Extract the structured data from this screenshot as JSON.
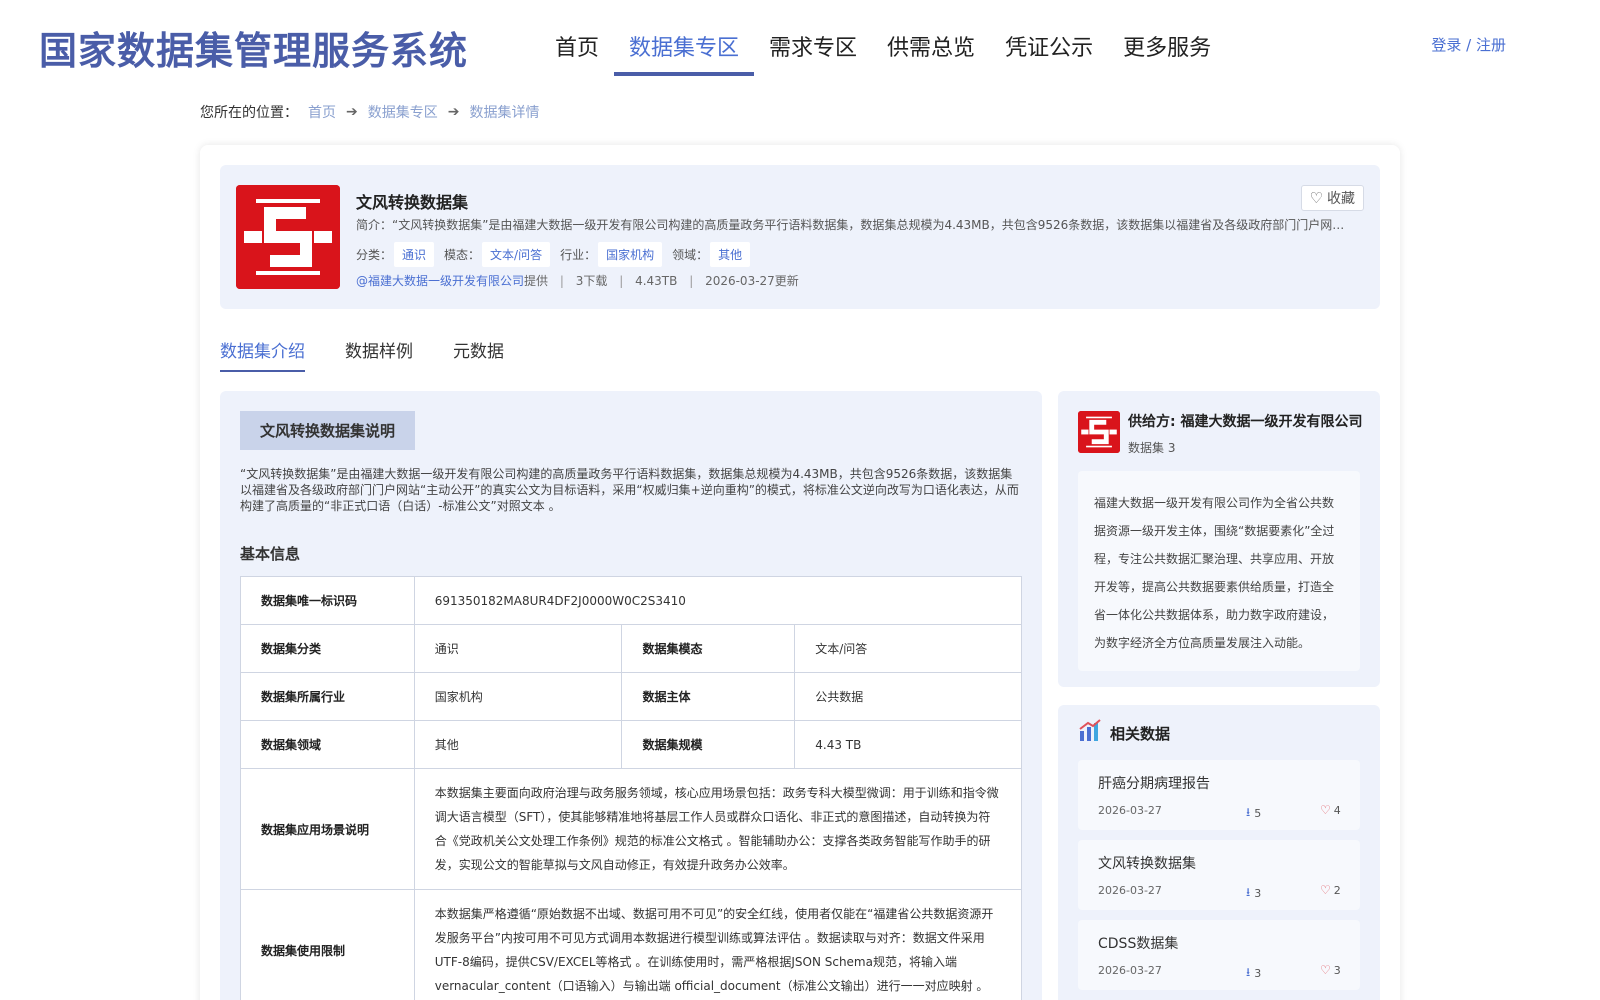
{
  "header": {
    "site_title": "国家数据集管理服务系统",
    "nav": [
      "首页",
      "数据集专区",
      "需求专区",
      "供需总览",
      "凭证公示",
      "更多服务"
    ],
    "active_nav": "数据集专区",
    "login": "登录 / 注册"
  },
  "breadcrumb": {
    "prefix": "您所在的位置：",
    "items": [
      "首页",
      "数据集专区",
      "数据集详情"
    ]
  },
  "dataset": {
    "title": "文风转换数据集",
    "favorite_label": "收藏",
    "summary": "简介：“文风转换数据集”是由福建大数据一级开发有限公司构建的高质量政务平行语料数据集，数据集总规模为4.43MB，共包含9526条数据，该数据集以福建省及各级政府部门门户网站“…",
    "tags": [
      {
        "label": "分类：",
        "value": "通识"
      },
      {
        "label": "模态：",
        "value": "文本/问答"
      },
      {
        "label": "行业：",
        "value": "国家机构"
      },
      {
        "label": "领域：",
        "value": "其他"
      }
    ],
    "provider": "@福建大数据一级开发有限公司",
    "provided_text": "提供",
    "downloads": "3下载",
    "size": "4.43TB",
    "updated": "2026-03-27更新"
  },
  "tabs": [
    "数据集介绍",
    "数据样例",
    "元数据"
  ],
  "intro": {
    "section_title": "文风转换数据集说明",
    "text": "“文风转换数据集”是由福建大数据一级开发有限公司构建的高质量政务平行语料数据集，数据集总规模为4.43MB，共包含9526条数据，该数据集以福建省及各级政府部门门户网站“主动公开”的真实公文为目标语料，采用“权威归集+逆向重构”的模式，将标准公文逆向改写为口语化表达，从而构建了高质量的“非正式口语（白话）-标准公文”对照文本 。",
    "basic_title": "基本信息",
    "table": {
      "id_key": "数据集唯一标识码",
      "id_val": "691350182MA8UR4DF2J0000W0C2S3410",
      "category_key": "数据集分类",
      "category_val": "通识",
      "modality_key": "数据集模态",
      "modality_val": "文本/问答",
      "industry_key": "数据集所属行业",
      "industry_val": "国家机构",
      "subject_key": "数据主体",
      "subject_val": "公共数据",
      "domain_key": "数据集领域",
      "domain_val": "其他",
      "scale_key": "数据集规模",
      "scale_val": "4.43 TB",
      "scenario_key": "数据集应用场景说明",
      "scenario_val": "本数据集主要面向政府治理与政务服务领域，核心应用场景包括：政务专科大模型微调：用于训练和指令微调大语言模型（SFT），使其能够精准地将基层工作人员或群众口语化、非正式的意图描述，自动转换为符合《党政机关公文处理工作条例》规范的标准公文格式 。智能辅助办公：支撑各类政务智能写作助手的研发，实现公文的智能草拟与文风自动修正，有效提升政务办公效率。",
      "limit_key": "数据集使用限制",
      "limit_val": "本数据集严格遵循“原始数据不出域、数据可用不可见”的安全红线，使用者仅能在“福建省公共数据资源开发服务平台”内按可用不可见方式调用本数据进行模型训练或算法评估 。数据读取与对齐：数据文件采用UTF-8编码，提供CSV/EXCEL等格式 。在训练使用时，需严格根据JSON Schema规范，将输入端 vernacular_content（口语输入）与输出端 official_document（标准公文输出）进行一一对应映射 。"
    }
  },
  "provider_card": {
    "name": "供给方: 福建大数据一级开发有限公司",
    "count": "数据集 3",
    "description": "福建大数据一级开发有限公司作为全省公共数据资源一级开发主体，围绕“数据要素化”全过程，专注公共数据汇聚治理、共享应用、开放开发等，提高公共数据要素供给质量，打造全省一体化公共数据体系，助力数字政府建设，为数字经济全方位高质量发展注入动能。"
  },
  "related": {
    "title": "相关数据",
    "items": [
      {
        "name": "肝癌分期病理报告",
        "date": "2026-03-27",
        "downloads": "5",
        "likes": "4"
      },
      {
        "name": "文风转换数据集",
        "date": "2026-03-27",
        "downloads": "3",
        "likes": "2"
      },
      {
        "name": "CDSS数据集",
        "date": "2026-03-27",
        "downloads": "3",
        "likes": "3"
      }
    ]
  },
  "colors": {
    "brand": "#4a5da8",
    "accent": "#4a6fd2",
    "card_bg": "#eef2fb",
    "logo_red": "#d9141b"
  },
  "icons": [
    "heart-icon",
    "arrow-right-icon",
    "download-icon",
    "bar-chart-icon",
    "company-logo"
  ]
}
